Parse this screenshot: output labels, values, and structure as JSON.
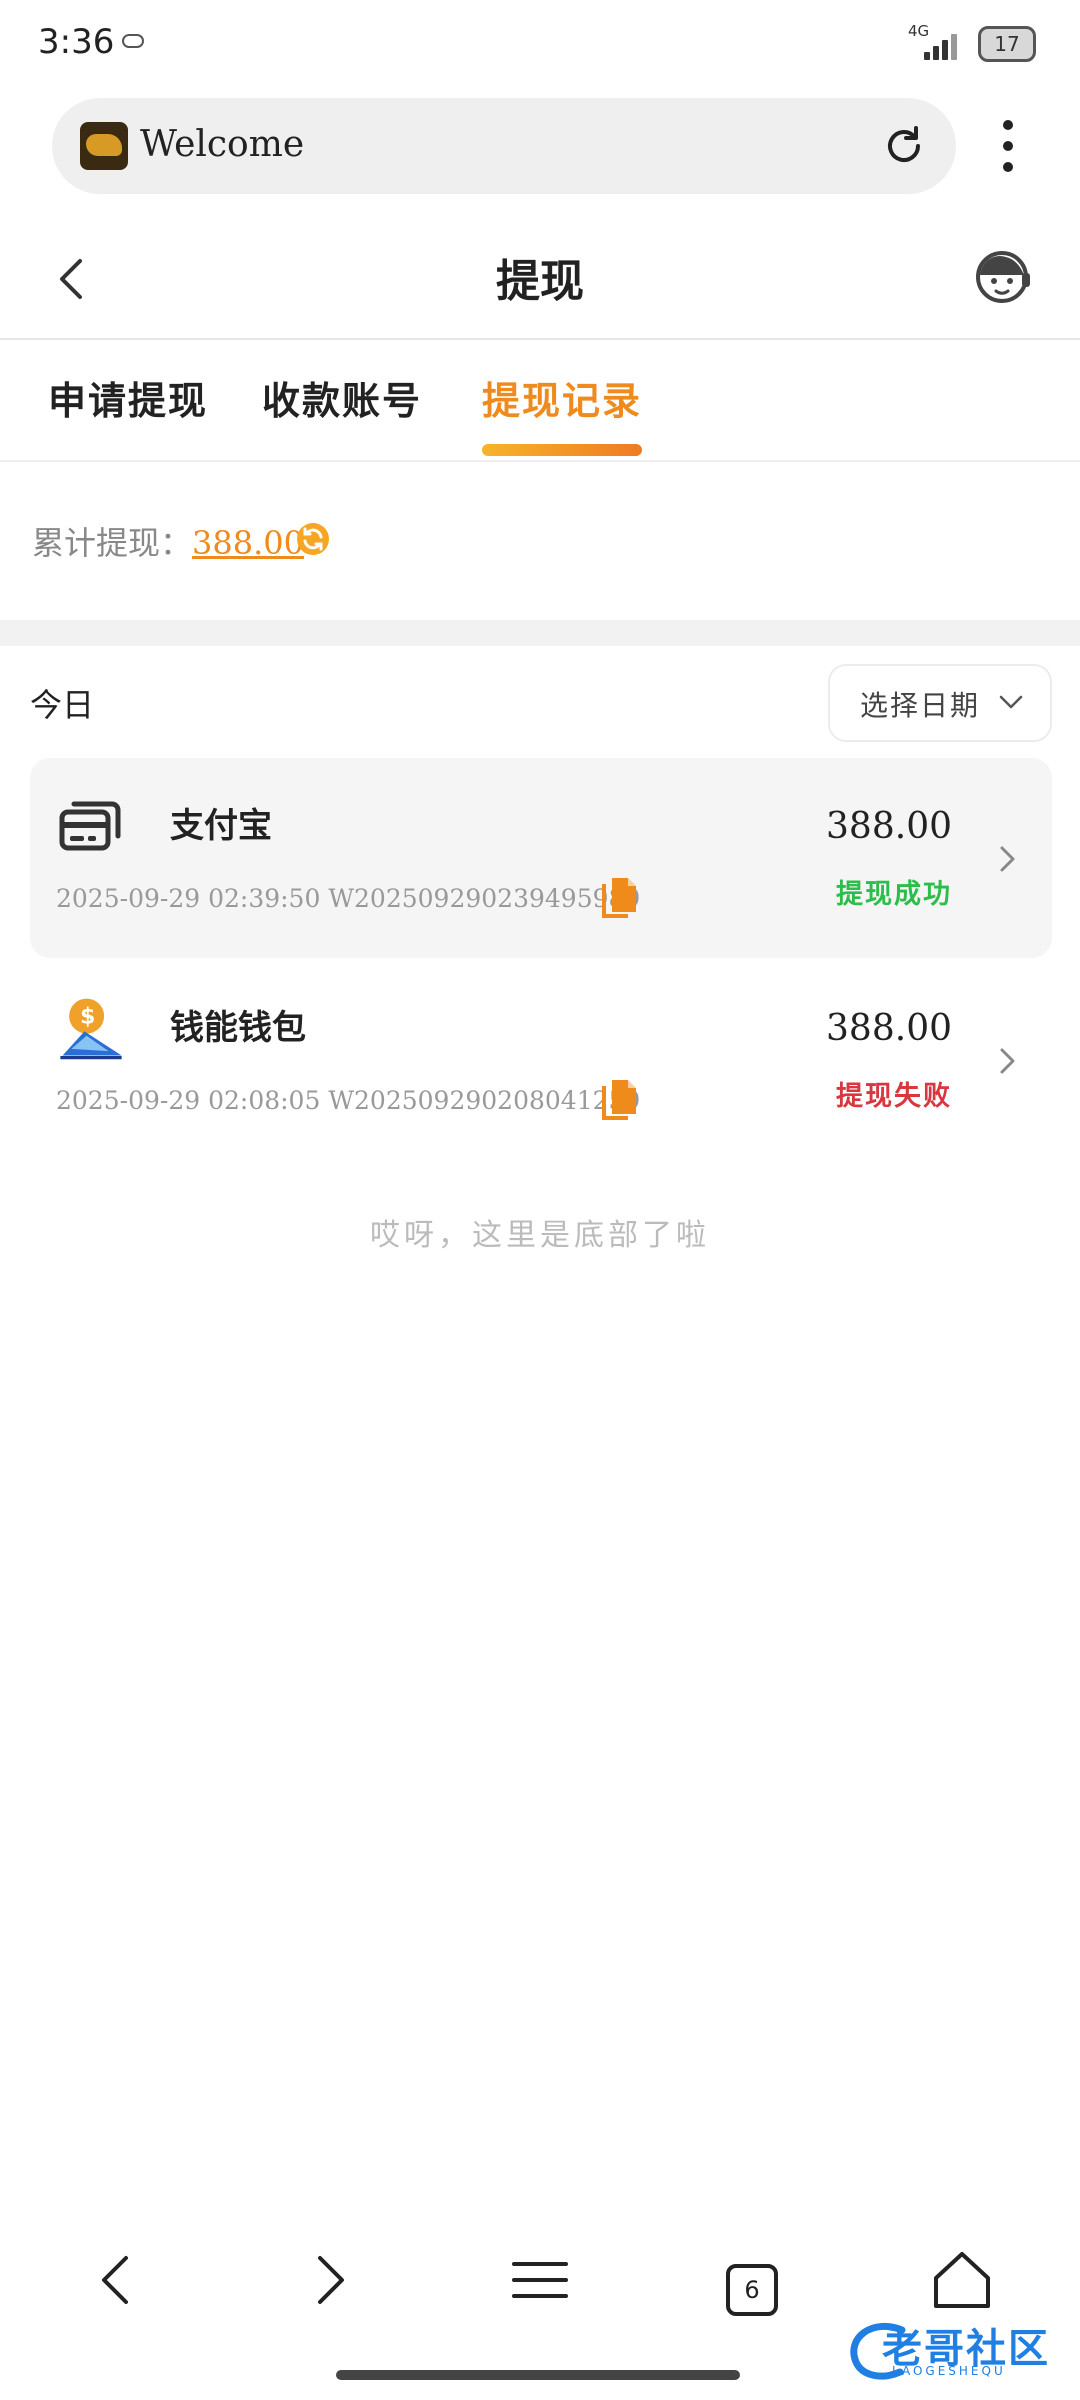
{
  "status_bar": {
    "time": "3:36",
    "network": "4G",
    "battery": "17"
  },
  "browser": {
    "title": "Welcome"
  },
  "header": {
    "title": "提现"
  },
  "tabs": [
    {
      "label": "申请提现",
      "active": false
    },
    {
      "label": "收款账号",
      "active": false
    },
    {
      "label": "提现记录",
      "active": true
    }
  ],
  "summary": {
    "label": "累计提现：",
    "amount": "388.00"
  },
  "list": {
    "group_label": "今日",
    "date_picker_label": "选择日期",
    "records": [
      {
        "method": "支付宝",
        "icon": "card-icon",
        "datetime_order": "2025-09-29 02:39:50 W2025092902394959​89",
        "amount": "388.00",
        "status": "提现成功",
        "status_color": "#2dbd4a"
      },
      {
        "method": "钱能钱包",
        "icon": "wallet-logo-icon",
        "datetime_order": "2025-09-29 02:08:05 W202509290208041259",
        "amount": "388.00",
        "status": "提现失败",
        "status_color": "#d8373f"
      }
    ],
    "end_note": "哎呀，这里是底部了啦"
  },
  "bottom_nav": {
    "tab_count": "6"
  },
  "watermark": {
    "text": "老哥社区",
    "sub": "LAOGESHEQU"
  },
  "colors": {
    "accent": "#ef8a1c",
    "success": "#2dbd4a",
    "fail": "#d8373f"
  }
}
